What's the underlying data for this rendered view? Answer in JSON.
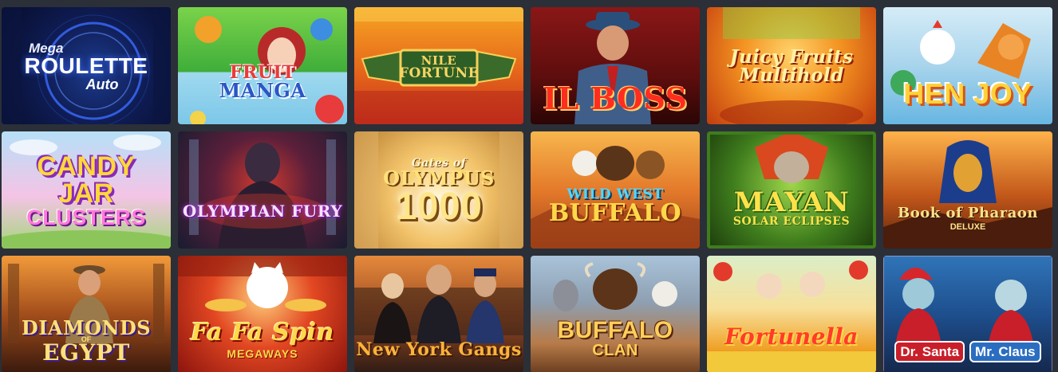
{
  "tiles": [
    {
      "line1": "Mega",
      "line2": "ROULETTE",
      "line3": "Auto",
      "icon": "roulette-wheel-icon"
    },
    {
      "line1": "FRUIT",
      "line2": "MANGA",
      "icon": "fruit-girl-icon"
    },
    {
      "line1": "NILE",
      "line2": "FORTUNE",
      "icon": "winged-scarab-icon"
    },
    {
      "line1": "IL BOSS",
      "icon": "mobster-icon"
    },
    {
      "line1": "Juicy Fruits",
      "line2": "Multihold",
      "icon": "fruit-bowl-icon"
    },
    {
      "line1": "HEN JOY",
      "icon": "hen-fox-icon"
    },
    {
      "line1": "CANDY",
      "line2": "JAR",
      "line3": "CLUSTERS",
      "icon": "candy-jar-icon"
    },
    {
      "line1": "OLYMPIAN FURY",
      "icon": "warrior-icon"
    },
    {
      "line1": "Gates of",
      "line2": "OLYMPUS",
      "line3": "1000",
      "icon": "zeus-gate-icon"
    },
    {
      "line1": "WILD WEST",
      "line2": "BUFFALO",
      "icon": "buffalo-eagle-icon"
    },
    {
      "line1": "MAYAN",
      "line2": "SOLAR ECLIPSES",
      "icon": "mayan-mask-icon"
    },
    {
      "line1": "Book of Pharaon",
      "line2": "DELUXE",
      "icon": "pharaoh-mask-icon"
    },
    {
      "line1": "DIAMONDS",
      "line2": "EGYPT",
      "line1b": "OF",
      "icon": "explorer-icon"
    },
    {
      "line1": "Fa Fa Spin",
      "line2": "MEGAWAYS",
      "icon": "lucky-cat-icon"
    },
    {
      "line1": "New York Gangs",
      "icon": "gangsters-icon"
    },
    {
      "line1": "BUFFALO",
      "line2": "CLAN",
      "icon": "buffalo-wolf-icon"
    },
    {
      "line1": "Fortunella",
      "icon": "lucky-kids-icon"
    },
    {
      "line1": "Dr. Santa",
      "line2": "Mr. Claus",
      "icon": "santa-duo-icon"
    }
  ],
  "colors": {
    "page_background": "#2b2f38"
  }
}
